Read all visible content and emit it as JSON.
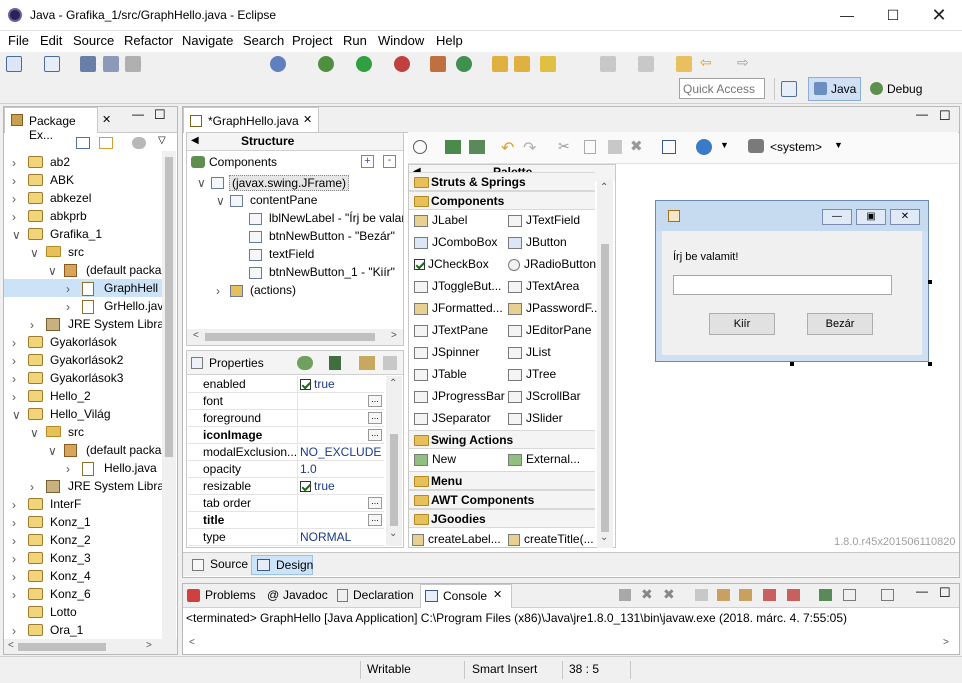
{
  "window": {
    "title": "Java - Grafika_1/src/GraphHello.java - Eclipse"
  },
  "menu": [
    "File",
    "Edit",
    "Source",
    "Refactor",
    "Navigate",
    "Search",
    "Project",
    "Run",
    "Window",
    "Help"
  ],
  "quick_access": {
    "placeholder": "Quick Access"
  },
  "perspectives": {
    "java": "Java",
    "debug": "Debug"
  },
  "package_explorer": {
    "tab": "Package Ex...",
    "rows": [
      {
        "label": "ab2",
        "indent": 0,
        "type": "proj",
        "tw": ">"
      },
      {
        "label": "ABK",
        "indent": 0,
        "type": "proj",
        "tw": ">"
      },
      {
        "label": "abkezel",
        "indent": 0,
        "type": "proj",
        "tw": ">"
      },
      {
        "label": "abkprb",
        "indent": 0,
        "type": "proj",
        "tw": ">"
      },
      {
        "label": "Grafika_1",
        "indent": 0,
        "type": "proj",
        "tw": "v"
      },
      {
        "label": "src",
        "indent": 1,
        "type": "folder",
        "tw": "v"
      },
      {
        "label": "(default packa",
        "indent": 2,
        "type": "pkg",
        "tw": "v"
      },
      {
        "label": "GraphHell",
        "indent": 3,
        "type": "jfile",
        "tw": ">",
        "selected": true
      },
      {
        "label": "GrHello.jav",
        "indent": 3,
        "type": "jfile",
        "tw": ">"
      },
      {
        "label": "JRE System Librar",
        "indent": 1,
        "type": "jre",
        "tw": ">"
      },
      {
        "label": "Gyakorlások",
        "indent": 0,
        "type": "proj",
        "tw": ">"
      },
      {
        "label": "Gyakorlások2",
        "indent": 0,
        "type": "proj",
        "tw": ">"
      },
      {
        "label": "Gyakorlások3",
        "indent": 0,
        "type": "proj",
        "tw": ">"
      },
      {
        "label": "Hello_2",
        "indent": 0,
        "type": "proj",
        "tw": ">"
      },
      {
        "label": "Hello_Világ",
        "indent": 0,
        "type": "proj",
        "tw": "v"
      },
      {
        "label": "src",
        "indent": 1,
        "type": "folder",
        "tw": "v"
      },
      {
        "label": "(default packa",
        "indent": 2,
        "type": "pkg",
        "tw": "v"
      },
      {
        "label": "Hello.java",
        "indent": 3,
        "type": "jfile",
        "tw": ">"
      },
      {
        "label": "JRE System Librar",
        "indent": 1,
        "type": "jre",
        "tw": ">"
      },
      {
        "label": "InterF",
        "indent": 0,
        "type": "proj",
        "tw": ">"
      },
      {
        "label": "Konz_1",
        "indent": 0,
        "type": "proj",
        "tw": ">"
      },
      {
        "label": "Konz_2",
        "indent": 0,
        "type": "proj",
        "tw": ">"
      },
      {
        "label": "Konz_3",
        "indent": 0,
        "type": "proj",
        "tw": ">"
      },
      {
        "label": "Konz_4",
        "indent": 0,
        "type": "proj",
        "tw": ">"
      },
      {
        "label": "Konz_6",
        "indent": 0,
        "type": "proj",
        "tw": ">"
      },
      {
        "label": "Lotto",
        "indent": 0,
        "type": "proj",
        "tw": ""
      },
      {
        "label": "Ora_1",
        "indent": 0,
        "type": "proj",
        "tw": ">"
      }
    ]
  },
  "editor": {
    "tab": "*GraphHello.java"
  },
  "structure": {
    "title": "Structure",
    "components_label": "Components",
    "rows": [
      {
        "label": "(javax.swing.JFrame)",
        "indent": 0,
        "tw": "v",
        "selected": true
      },
      {
        "label": "contentPane",
        "indent": 1,
        "tw": "v"
      },
      {
        "label": "lblNewLabel - \"Írj be valam",
        "indent": 2,
        "tw": ""
      },
      {
        "label": "btnNewButton - \"Bezár\"",
        "indent": 2,
        "tw": ""
      },
      {
        "label": "textField",
        "indent": 2,
        "tw": ""
      },
      {
        "label": "btnNewButton_1 - \"Kiír\"",
        "indent": 2,
        "tw": ""
      },
      {
        "label": "(actions)",
        "indent": 1,
        "tw": ">"
      }
    ]
  },
  "properties": {
    "title": "Properties",
    "rows": [
      {
        "name": "enabled",
        "value": "true",
        "check": true
      },
      {
        "name": "font",
        "value": "",
        "dots": true
      },
      {
        "name": "foreground",
        "value": "",
        "dots": true
      },
      {
        "name": "iconImage",
        "value": "",
        "dots": true,
        "bold": true
      },
      {
        "name": "modalExclusion...",
        "value": "NO_EXCLUDE"
      },
      {
        "name": "opacity",
        "value": "1.0"
      },
      {
        "name": "resizable",
        "value": "true",
        "check": true
      },
      {
        "name": "tab order",
        "value": "",
        "dots": true
      },
      {
        "name": "title",
        "value": "",
        "dots": true,
        "bold": true
      },
      {
        "name": "type",
        "value": "NORMAL"
      }
    ]
  },
  "palette": {
    "title": "Palette",
    "system": "<system>",
    "top_cat": "Struts & Springs",
    "components_cat": "Components",
    "items": [
      [
        "JLabel",
        "JTextField"
      ],
      [
        "JComboBox",
        "JButton"
      ],
      [
        "JCheckBox",
        "JRadioButton"
      ],
      [
        "JToggleBut...",
        "JTextArea"
      ],
      [
        "JFormatted...",
        "JPasswordF..."
      ],
      [
        "JTextPane",
        "JEditorPane"
      ],
      [
        "JSpinner",
        "JList"
      ],
      [
        "JTable",
        "JTree"
      ],
      [
        "JProgressBar",
        "JScrollBar"
      ],
      [
        "JSeparator",
        "JSlider"
      ]
    ],
    "swing_actions": "Swing Actions",
    "actions": [
      "New",
      "External..."
    ],
    "menu_cat": "Menu",
    "awt_cat": "AWT Components",
    "jgoodies_cat": "JGoodies",
    "jgoodies_items": [
      "createLabel...",
      "createTitle(..."
    ]
  },
  "preview": {
    "label_text": "Írj be valamit!",
    "btn_kiir": "Kiír",
    "btn_bezar": "Bezár",
    "version": "1.8.0.r45x201506110820"
  },
  "editor_tabs": {
    "source": "Source",
    "design": "Design"
  },
  "bottom": {
    "tabs": [
      "Problems",
      "Javadoc",
      "Declaration",
      "Console"
    ],
    "console_text": "<terminated> GraphHello [Java Application] C:\\Program Files (x86)\\Java\\jre1.8.0_131\\bin\\javaw.exe (2018. márc. 4. 7:55:05)"
  },
  "status": {
    "writable": "Writable",
    "insert": "Smart Insert",
    "position": "38 : 5"
  }
}
